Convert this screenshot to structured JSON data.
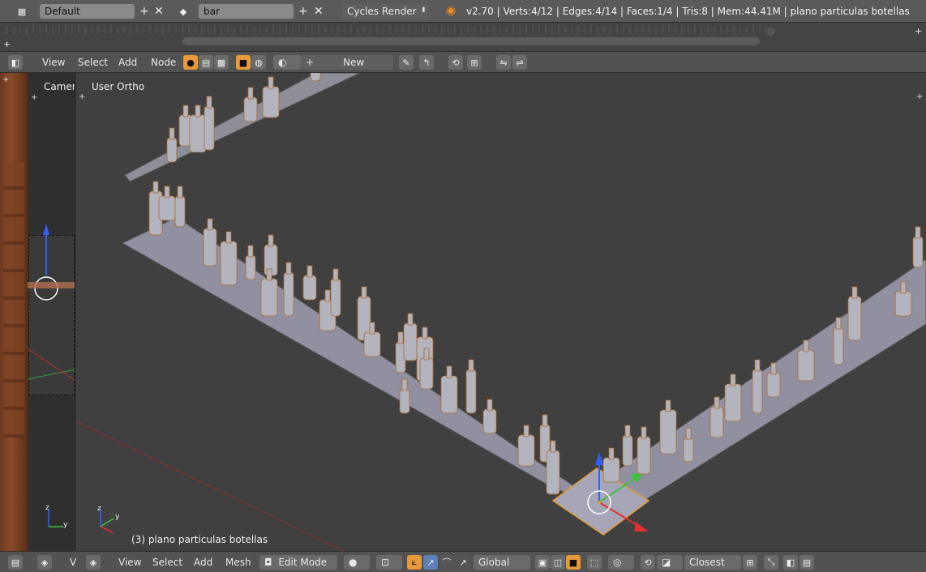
{
  "topbar": {
    "screen_layout": "Default",
    "scene": "bar",
    "render_engine": "Cycles Render",
    "stats": "v2.70 | Verts:4/12 | Edges:4/14 | Faces:1/4 | Tris:8 | Mem:44.41M | plano particulas botellas"
  },
  "node_header": {
    "menus": [
      "View",
      "Select",
      "Add",
      "Node"
    ],
    "new_label": "New"
  },
  "left_view": {
    "camera_label": "Camera"
  },
  "viewport": {
    "view_label": "User Ortho",
    "object_label": "(3) plano particulas botellas"
  },
  "bottom_header": {
    "left_label": "V",
    "menus": [
      "View",
      "Select",
      "Add",
      "Mesh"
    ],
    "mode": "Edit Mode",
    "orientation": "Global",
    "snap_target": "Closest"
  },
  "colors": {
    "accent": "#e89a3a",
    "axis_x": "#e03030",
    "axis_y": "#40c040",
    "axis_z": "#3060ff"
  }
}
